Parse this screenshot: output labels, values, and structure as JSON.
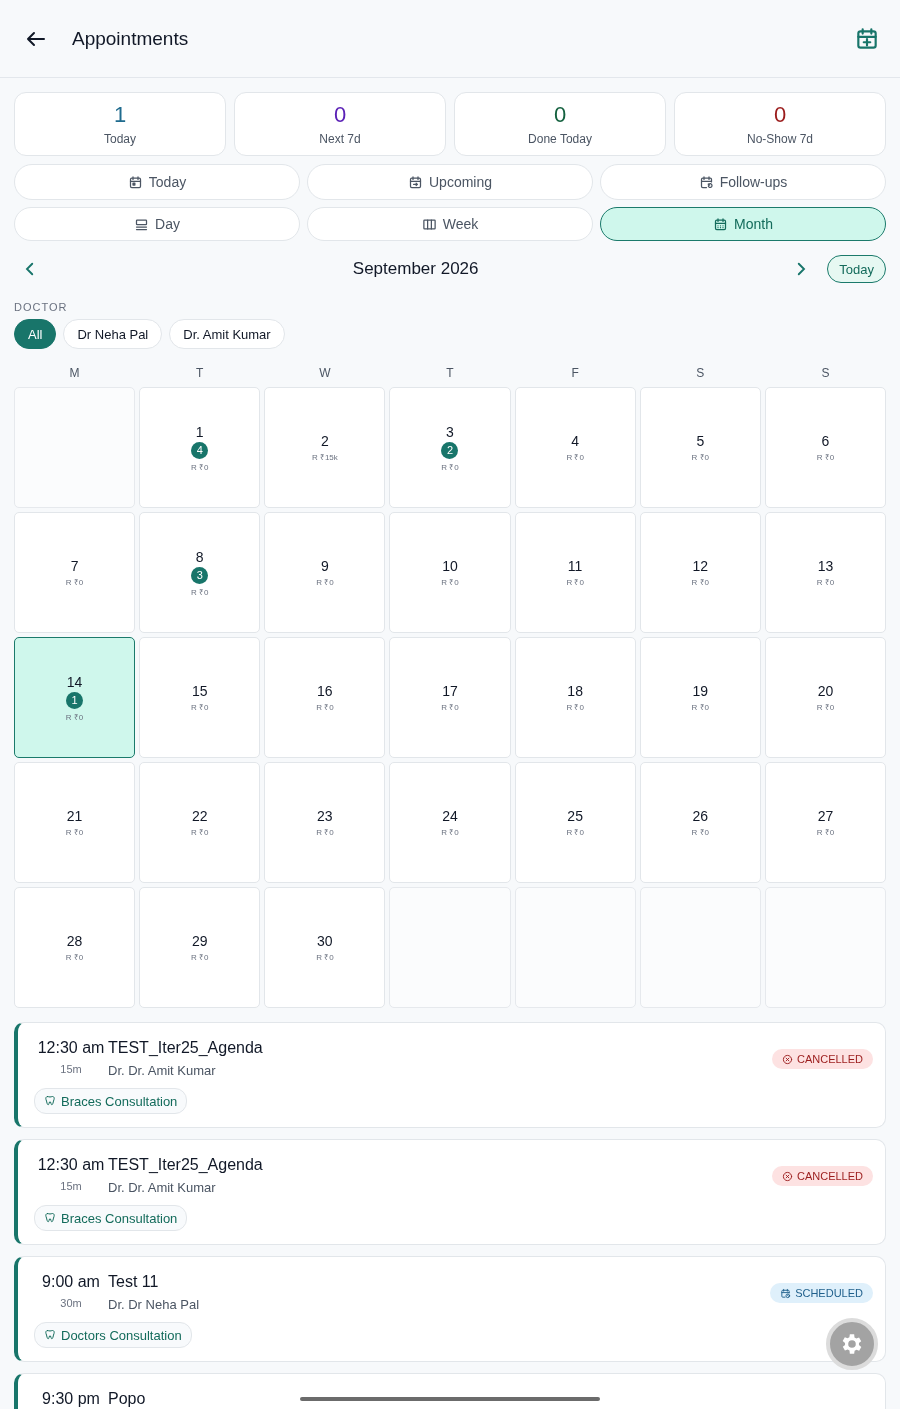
{
  "header": {
    "title": "Appointments"
  },
  "stats": [
    {
      "value": "1",
      "label": "Today",
      "color": "#1f6b8e"
    },
    {
      "value": "0",
      "label": "Next 7d",
      "color": "#5b21b6"
    },
    {
      "value": "0",
      "label": "Done Today",
      "color": "#14613f"
    },
    {
      "value": "0",
      "label": "No-Show 7d",
      "color": "#9b1c1c"
    }
  ],
  "filters": [
    {
      "label": "Today",
      "kind": "today",
      "selected": false
    },
    {
      "label": "Upcoming",
      "kind": "upcoming",
      "selected": false
    },
    {
      "label": "Follow-ups",
      "kind": "followups",
      "selected": false
    }
  ],
  "views": [
    {
      "label": "Day",
      "kind": "day",
      "selected": false
    },
    {
      "label": "Week",
      "kind": "week",
      "selected": false
    },
    {
      "label": "Month",
      "kind": "month",
      "selected": true
    }
  ],
  "month_nav": {
    "title": "September 2026",
    "today_button": "Today"
  },
  "doctor_filter": {
    "label": "DOCTOR",
    "chips": [
      {
        "label": "All",
        "selected": true
      },
      {
        "label": "Dr Neha Pal",
        "selected": false
      },
      {
        "label": "Dr. Amit Kumar",
        "selected": false
      }
    ]
  },
  "calendar": {
    "weekdays": [
      "M",
      "T",
      "W",
      "T",
      "F",
      "S",
      "S"
    ],
    "days": [
      {
        "kind": "blank"
      },
      {
        "day": "1",
        "count": "4",
        "revenue": "R ₹0",
        "selected": false
      },
      {
        "day": "2",
        "revenue": "R ₹15k",
        "selected": false
      },
      {
        "day": "3",
        "count": "2",
        "revenue": "R ₹0",
        "selected": false
      },
      {
        "day": "4",
        "revenue": "R ₹0",
        "selected": false
      },
      {
        "day": "5",
        "revenue": "R ₹0",
        "selected": false
      },
      {
        "day": "6",
        "revenue": "R ₹0",
        "selected": false
      },
      {
        "day": "7",
        "revenue": "R ₹0",
        "selected": false
      },
      {
        "day": "8",
        "count": "3",
        "revenue": "R ₹0",
        "selected": false
      },
      {
        "day": "9",
        "revenue": "R ₹0",
        "selected": false
      },
      {
        "day": "10",
        "revenue": "R ₹0",
        "selected": false
      },
      {
        "day": "11",
        "revenue": "R ₹0",
        "selected": false
      },
      {
        "day": "12",
        "revenue": "R ₹0",
        "selected": false
      },
      {
        "day": "13",
        "revenue": "R ₹0",
        "selected": false
      },
      {
        "day": "14",
        "count": "1",
        "revenue": "R ₹0",
        "selected": true
      },
      {
        "day": "15",
        "revenue": "R ₹0",
        "selected": false
      },
      {
        "day": "16",
        "revenue": "R ₹0",
        "selected": false
      },
      {
        "day": "17",
        "revenue": "R ₹0",
        "selected": false
      },
      {
        "day": "18",
        "revenue": "R ₹0",
        "selected": false
      },
      {
        "day": "19",
        "revenue": "R ₹0",
        "selected": false
      },
      {
        "day": "20",
        "revenue": "R ₹0",
        "selected": false
      },
      {
        "day": "21",
        "revenue": "R ₹0",
        "selected": false
      },
      {
        "day": "22",
        "revenue": "R ₹0",
        "selected": false
      },
      {
        "day": "23",
        "revenue": "R ₹0",
        "selected": false
      },
      {
        "day": "24",
        "revenue": "R ₹0",
        "selected": false
      },
      {
        "day": "25",
        "revenue": "R ₹0",
        "selected": false
      },
      {
        "day": "26",
        "revenue": "R ₹0",
        "selected": false
      },
      {
        "day": "27",
        "revenue": "R ₹0",
        "selected": false
      },
      {
        "day": "28",
        "revenue": "R ₹0",
        "selected": false
      },
      {
        "day": "29",
        "revenue": "R ₹0",
        "selected": false
      },
      {
        "day": "30",
        "revenue": "R ₹0",
        "selected": false
      },
      {
        "kind": "blank"
      },
      {
        "kind": "blank"
      },
      {
        "kind": "blank"
      },
      {
        "kind": "blank"
      }
    ]
  },
  "appointments": [
    {
      "time": "12:30 am",
      "duration": "15m",
      "title": "TEST_Iter25_Agenda",
      "doctor": "Dr. Dr. Amit Kumar",
      "status": "CANCELLED",
      "kind": "cancelled",
      "service": "Braces Consultation"
    },
    {
      "time": "12:30 am",
      "duration": "15m",
      "title": "TEST_Iter25_Agenda",
      "doctor": "Dr. Dr. Amit Kumar",
      "status": "CANCELLED",
      "kind": "cancelled",
      "service": "Braces Consultation"
    },
    {
      "time": "9:00 am",
      "duration": "30m",
      "title": "Test 11",
      "doctor": "Dr. Dr Neha Pal",
      "status": "SCHEDULED",
      "kind": "scheduled",
      "service": "Doctors Consultation"
    },
    {
      "time": "9:30 pm",
      "title": "Popo"
    }
  ]
}
